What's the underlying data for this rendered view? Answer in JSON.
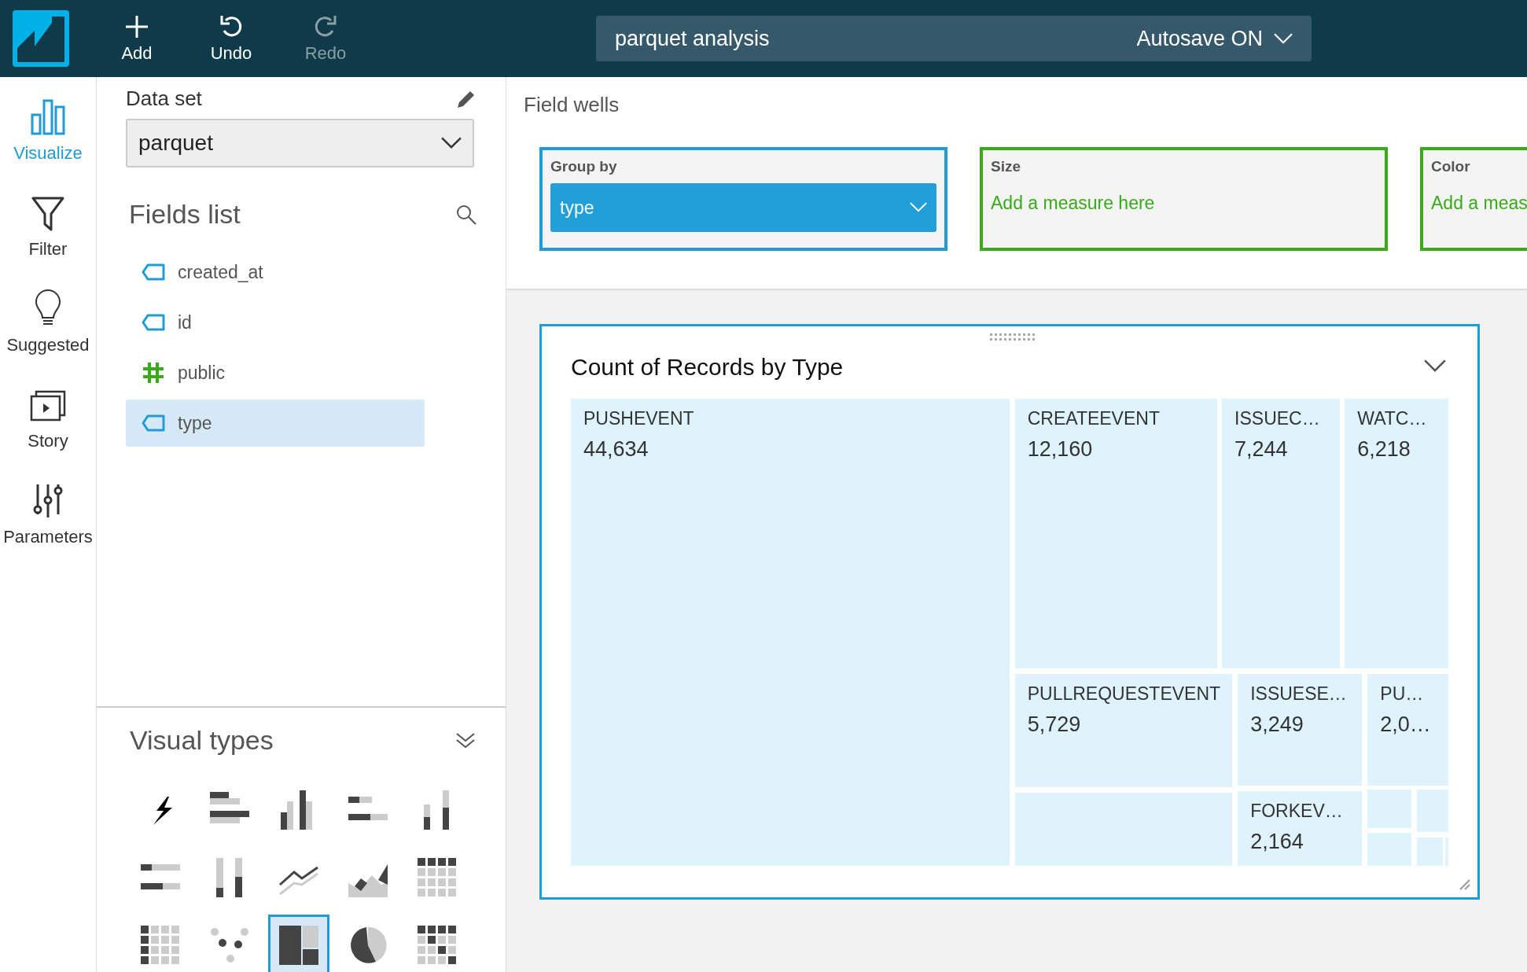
{
  "toolbar": [
    {
      "label": "Add",
      "kind": "add",
      "disabled": false
    },
    {
      "label": "Undo",
      "kind": "undo",
      "disabled": false
    },
    {
      "label": "Redo",
      "kind": "redo",
      "disabled": true
    }
  ],
  "analysis": {
    "name": "parquet analysis",
    "autosave": "Autosave ON"
  },
  "nav": [
    {
      "label": "Visualize",
      "kind": "visualize",
      "selected": true
    },
    {
      "label": "Filter",
      "kind": "filter",
      "selected": false
    },
    {
      "label": "Suggested",
      "kind": "suggested",
      "selected": false
    },
    {
      "label": "Story",
      "kind": "story",
      "selected": false
    },
    {
      "label": "Parameters",
      "kind": "parameters",
      "selected": false
    }
  ],
  "data_set": {
    "title": "Data set",
    "value": "parquet"
  },
  "fields_list": {
    "title": "Fields list",
    "items": [
      {
        "label": "created_at",
        "kind": "dimension",
        "selected": false
      },
      {
        "label": "id",
        "kind": "dimension",
        "selected": false
      },
      {
        "label": "public",
        "kind": "measure",
        "selected": false
      },
      {
        "label": "type",
        "kind": "dimension",
        "selected": true
      }
    ]
  },
  "visual_types": {
    "title": "Visual types",
    "items": [
      {
        "kind": "autograph",
        "selected": false
      },
      {
        "kind": "hbar",
        "selected": false
      },
      {
        "kind": "vbar",
        "selected": false
      },
      {
        "kind": "hstack",
        "selected": false
      },
      {
        "kind": "vstack",
        "selected": false
      },
      {
        "kind": "hpercent",
        "selected": false
      },
      {
        "kind": "vpercent",
        "selected": false
      },
      {
        "kind": "line",
        "selected": false
      },
      {
        "kind": "area",
        "selected": false
      },
      {
        "kind": "table",
        "selected": false
      },
      {
        "kind": "pivot",
        "selected": false
      },
      {
        "kind": "scatter",
        "selected": false
      },
      {
        "kind": "treemap",
        "selected": true
      },
      {
        "kind": "pie",
        "selected": false
      },
      {
        "kind": "heatmap",
        "selected": false
      }
    ]
  },
  "field_wells": {
    "title": "Field wells",
    "wells": [
      {
        "label": "Group by",
        "kind": "filled",
        "value": "type"
      },
      {
        "label": "Size",
        "kind": "empty",
        "value": "Add a measure here"
      },
      {
        "label": "Color",
        "kind": "empty",
        "value": "Add a meas"
      }
    ]
  },
  "visual": {
    "title": "Count of Records by Type",
    "tiles": [
      {
        "label": "PUSHEVENT",
        "value": "44,634"
      },
      {
        "label": "CREATEEVENT",
        "value": "12,160"
      },
      {
        "label": "ISSUEC…",
        "value": "7,244"
      },
      {
        "label": "WATC…",
        "value": "6,218"
      },
      {
        "label": "PULLREQUESTEVENT",
        "value": "5,729"
      },
      {
        "label": "ISSUESE…",
        "value": "3,249"
      },
      {
        "label": "PU…",
        "value": "2,0…"
      },
      {
        "label": "FORKEV…",
        "value": "2,164"
      }
    ]
  }
}
